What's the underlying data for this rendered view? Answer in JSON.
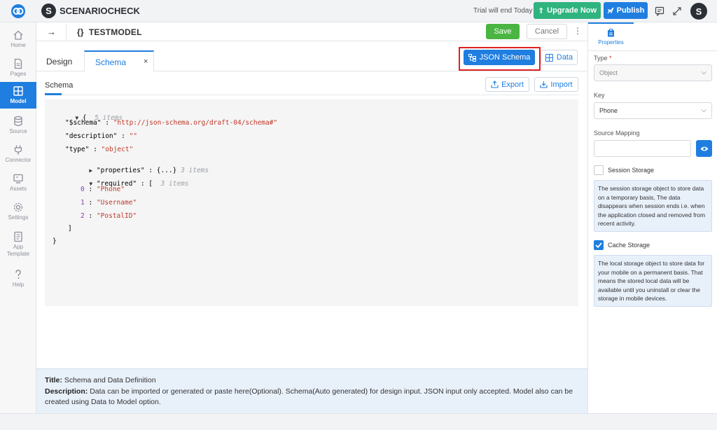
{
  "app": {
    "name": "SCENARIOCHECK",
    "avatar_letter": "S",
    "trial_text": "Trial will end Today",
    "upgrade_label": "Upgrade Now",
    "publish_label": "Publish",
    "user_letter": "S"
  },
  "sidebar": {
    "items": [
      {
        "label": "Home",
        "icon": "home-icon"
      },
      {
        "label": "Pages",
        "icon": "pages-icon"
      },
      {
        "label": "Model",
        "icon": "grid-icon",
        "active": true
      },
      {
        "label": "Source",
        "icon": "database-icon"
      },
      {
        "label": "Connector",
        "icon": "plug-icon"
      },
      {
        "label": "Assets",
        "icon": "monitor-icon"
      },
      {
        "label": "Settings",
        "icon": "gear-icon"
      },
      {
        "label": "App\nTemplate",
        "icon": "template-icon"
      },
      {
        "label": "Help",
        "icon": "help-icon"
      }
    ]
  },
  "header": {
    "model_icon": "{}",
    "model_title": "TESTMODEL",
    "save_label": "Save",
    "cancel_label": "Cancel"
  },
  "tabs": {
    "design": "Design",
    "schema": "Schema",
    "close": "×"
  },
  "view_toggle": {
    "json_schema": "JSON Schema",
    "data": "Data"
  },
  "schema_section": {
    "label": "Schema",
    "export": "Export",
    "import": "Import"
  },
  "json": {
    "root_open": "{",
    "root_meta": "5 items",
    "schema_key": "\"$schema\"",
    "schema_val": "\"http://json-schema.org/draft-04/schema#\"",
    "desc_key": "\"description\"",
    "desc_val": "\"\"",
    "type_key": "\"type\"",
    "type_val": "\"object\"",
    "props_key": "\"properties\"",
    "props_val": "{...}",
    "props_meta": "3 items",
    "req_key": "\"required\"",
    "req_open": "[",
    "req_meta": "3 items",
    "req_items": [
      {
        "idx": "0",
        "val": "\"Phone\""
      },
      {
        "idx": "1",
        "val": "\"Username\""
      },
      {
        "idx": "2",
        "val": "\"PostalID\""
      }
    ],
    "req_close": "]",
    "root_close": "}",
    "colon": ":"
  },
  "info": {
    "title_label": "Title:",
    "title_text": "Schema and Data Definition",
    "desc_label": "Description:",
    "desc_text": "Data can be imported or generated or paste here(Optional). Schema(Auto generated) for design input. JSON input only accepted. Model also can be created using Data to Model option."
  },
  "properties": {
    "tab_label": "Properties",
    "type_label": "Type",
    "type_value": "Object",
    "key_label": "Key",
    "key_value": "Phone",
    "source_mapping_label": "Source Mapping",
    "source_mapping_value": "",
    "session_label": "Session Storage",
    "session_checked": false,
    "session_tip": "The session storage object to store data on a temporary basis, The data disappears when session ends i.e. when the application closed and removed from recent activity.",
    "cache_label": "Cache Storage",
    "cache_checked": true,
    "cache_tip": "The local storage object to store data for your mobile on a permanent basis. That means the stored local data will be available until you uninstall or clear the storage in mobile devices."
  },
  "colors": {
    "primary": "#1f7ee0",
    "success": "#4bb543",
    "upgrade": "#2fb37f",
    "highlight": "#e02020"
  }
}
